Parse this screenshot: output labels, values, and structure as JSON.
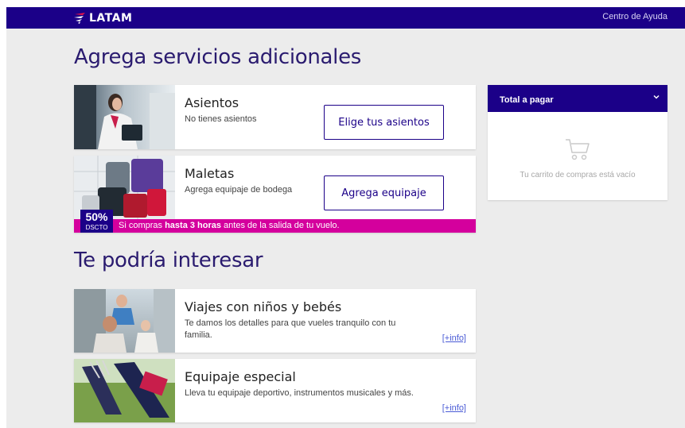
{
  "header": {
    "brand": "LATAM",
    "help_link": "Centro de Ayuda"
  },
  "services": {
    "title": "Agrega servicios adicionales",
    "seats": {
      "title": "Asientos",
      "subtitle": "No tienes asientos",
      "button": "Elige tus asientos"
    },
    "bags": {
      "title": "Maletas",
      "subtitle": "Agrega equipaje de bodega",
      "button": "Agrega equipaje",
      "badge_pct": "50%",
      "badge_label": "DSCTO",
      "promo_prefix": "Si compras ",
      "promo_bold": "hasta 3 horas",
      "promo_suffix": " antes de la salida de tu vuelo."
    }
  },
  "interest": {
    "title": "Te podría interesar",
    "items": [
      {
        "title": "Viajes con niños y bebés",
        "subtitle": "Te damos los detalles para que vueles tranquilo con tu familia.",
        "link": "[+info]"
      },
      {
        "title": "Equipaje especial",
        "subtitle": "Lleva tu equipaje deportivo, instrumentos musicales y más.",
        "link": "[+info]"
      }
    ]
  },
  "cart": {
    "title": "Total a pagar",
    "empty_text": "Tu carrito de compras está vacío",
    "icon": "shopping-cart-icon"
  },
  "colors": {
    "brand_indigo": "#1b0088",
    "promo_magenta": "#d4009d",
    "background": "#ececec"
  }
}
